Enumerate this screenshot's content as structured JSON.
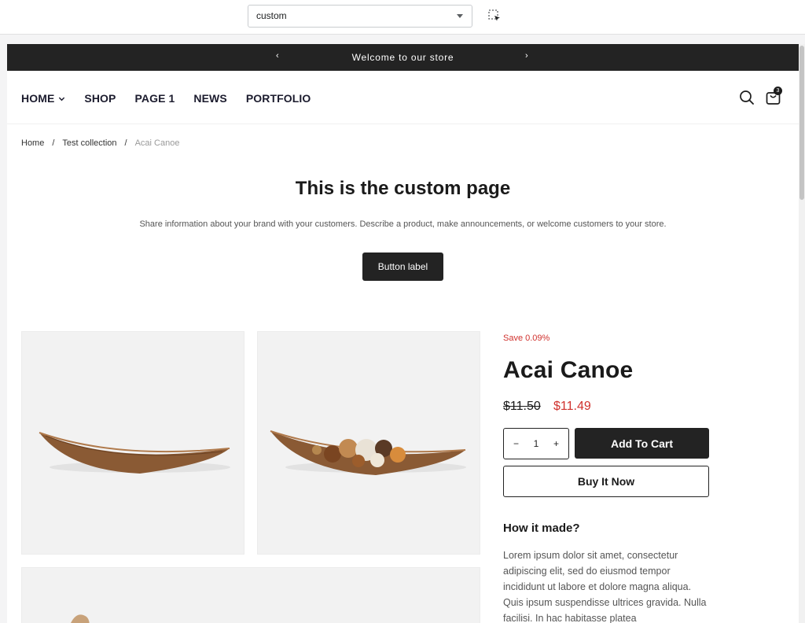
{
  "editor": {
    "template_select_value": "custom",
    "inspect_icon": "inspect-selection-icon"
  },
  "announcement": {
    "message": "Welcome to our store",
    "prev_arrow": "‹",
    "next_arrow": "›"
  },
  "nav": {
    "items": [
      {
        "label": "HOME",
        "has_dropdown": true
      },
      {
        "label": "SHOP"
      },
      {
        "label": "PAGE 1"
      },
      {
        "label": "NEWS"
      },
      {
        "label": "PORTFOLIO"
      }
    ],
    "cart_count": "3"
  },
  "breadcrumb": {
    "home": "Home",
    "sep": "/",
    "collection": "Test collection",
    "current": "Acai Canoe"
  },
  "custom_section": {
    "title": "This is the custom page",
    "description": "Share information about your brand with your customers. Describe a product, make announcements, or welcome customers to your store.",
    "button_label": "Button label"
  },
  "product": {
    "save_badge": "Save 0.09%",
    "title": "Acai Canoe",
    "price_compare": "$11.50",
    "price": "$11.49",
    "quantity": "1",
    "qty_minus": "−",
    "qty_plus": "+",
    "add_to_cart": "Add To Cart",
    "buy_now": "Buy It Now",
    "how_title": "How it made?",
    "how_text": "Lorem ipsum dolor sit amet, consectetur adipiscing elit, sed do eiusmod tempor incididunt ut labore et dolore magna aliqua. Quis ipsum suspendisse ultrices gravida. Nulla facilisi. In hac habitasse platea"
  },
  "colors": {
    "dark": "#232323",
    "sale_red": "#d0312d"
  }
}
